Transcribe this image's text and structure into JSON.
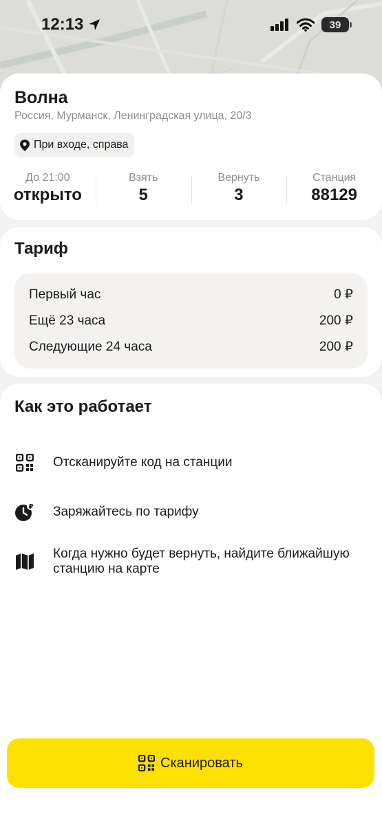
{
  "status_bar": {
    "time": "12:13",
    "battery": "39"
  },
  "station": {
    "title": "Волна",
    "address": "Россия, Мурманск, Ленинградская улица, 20/3",
    "entrance": "При входе, справа",
    "stats": [
      {
        "label": "До 21:00",
        "value": "открыто"
      },
      {
        "label": "Взять",
        "value": "5"
      },
      {
        "label": "Вернуть",
        "value": "3"
      },
      {
        "label": "Станция",
        "value": "88129"
      }
    ]
  },
  "tariff": {
    "title": "Тариф",
    "rows": [
      {
        "name": "Первый час",
        "price": "0 ₽"
      },
      {
        "name": "Ещё 23 часа",
        "price": "200 ₽"
      },
      {
        "name": "Следующие 24 часа",
        "price": "200 ₽"
      }
    ]
  },
  "how": {
    "title": "Как это работает",
    "steps": [
      {
        "icon": "qr-code-icon",
        "text": "Отсканируйте код на станции"
      },
      {
        "icon": "ruble-clock-icon",
        "text": "Заряжайтесь по тарифу"
      },
      {
        "icon": "map-icon",
        "text": "Когда нужно будет вернуть, найдите ближайшую станцию на карте"
      }
    ]
  },
  "scan_button": {
    "label": "Сканировать",
    "icon": "qr-code-icon",
    "color": "#fce000"
  }
}
